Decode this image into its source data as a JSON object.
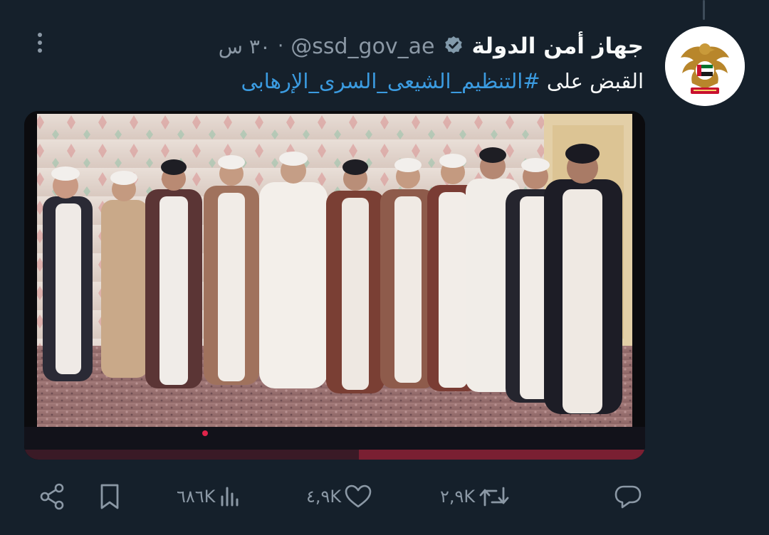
{
  "tweet": {
    "display_name": "جهاز أمن الدولة",
    "handle": "@ssd_gov_ae",
    "separator": "·",
    "time": "٣٠ س",
    "text_prefix": "القبض على ",
    "hashtag": "#التنظيم_الشيعى_السرى_الإرهابى"
  },
  "media": {
    "type": "video",
    "muted": true,
    "mute_icon": "volume-muted-icon"
  },
  "actions": {
    "reply": {
      "icon": "reply-icon",
      "count": ""
    },
    "retweet": {
      "icon": "retweet-icon",
      "count": "٢,٩K"
    },
    "like": {
      "icon": "heart-icon",
      "count": "٤,٩K"
    },
    "views": {
      "icon": "views-icon",
      "count": "٦٨٦K"
    },
    "bookmark": {
      "icon": "bookmark-icon"
    },
    "share": {
      "icon": "share-icon"
    }
  },
  "colors": {
    "background": "#15202b",
    "text": "#f7f9f9",
    "secondary": "#8b98a5",
    "link": "#3b9be0"
  }
}
